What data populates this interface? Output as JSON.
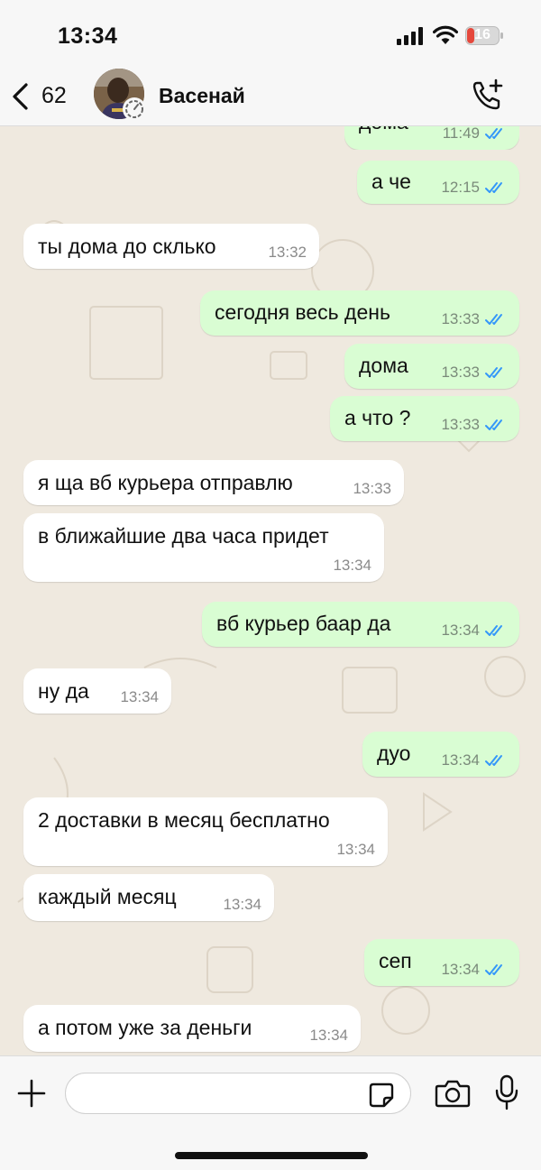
{
  "status": {
    "time": "13:34",
    "battery": "16"
  },
  "header": {
    "back_count": "62",
    "name": "Васенай"
  },
  "messages": [
    {
      "dir": "out",
      "text": "дома",
      "time": "11:49",
      "read": true
    },
    {
      "dir": "out",
      "text": "а че",
      "time": "12:15",
      "read": true
    },
    {
      "dir": "in",
      "text": "ты дома до склько",
      "time": "13:32"
    },
    {
      "dir": "out",
      "text": "сегодня весь день",
      "time": "13:33",
      "read": true
    },
    {
      "dir": "out",
      "text": "дома",
      "time": "13:33",
      "read": true
    },
    {
      "dir": "out",
      "text": "а что ?",
      "time": "13:33",
      "read": true
    },
    {
      "dir": "in",
      "text": "я ща вб курьера отправлю",
      "time": "13:33"
    },
    {
      "dir": "in",
      "text": "в ближайшие два часа придет",
      "time": "13:34"
    },
    {
      "dir": "out",
      "text": "вб курьер баар да",
      "time": "13:34",
      "read": true
    },
    {
      "dir": "in",
      "text": "ну да",
      "time": "13:34"
    },
    {
      "dir": "out",
      "text": "дуо",
      "time": "13:34",
      "read": true
    },
    {
      "dir": "in",
      "text": "2 доставки в месяц бесплатно",
      "time": "13:34"
    },
    {
      "dir": "in",
      "text": "каждый месяц",
      "time": "13:34"
    },
    {
      "dir": "out",
      "text": "сеп",
      "time": "13:34",
      "read": true
    },
    {
      "dir": "in",
      "text": "а потом уже за деньги",
      "time": "13:34"
    }
  ],
  "input": {
    "value": "",
    "placeholder": ""
  },
  "colors": {
    "outgoing": "#d9fdd3",
    "incoming": "#ffffff",
    "read_ticks": "#3497f9"
  }
}
